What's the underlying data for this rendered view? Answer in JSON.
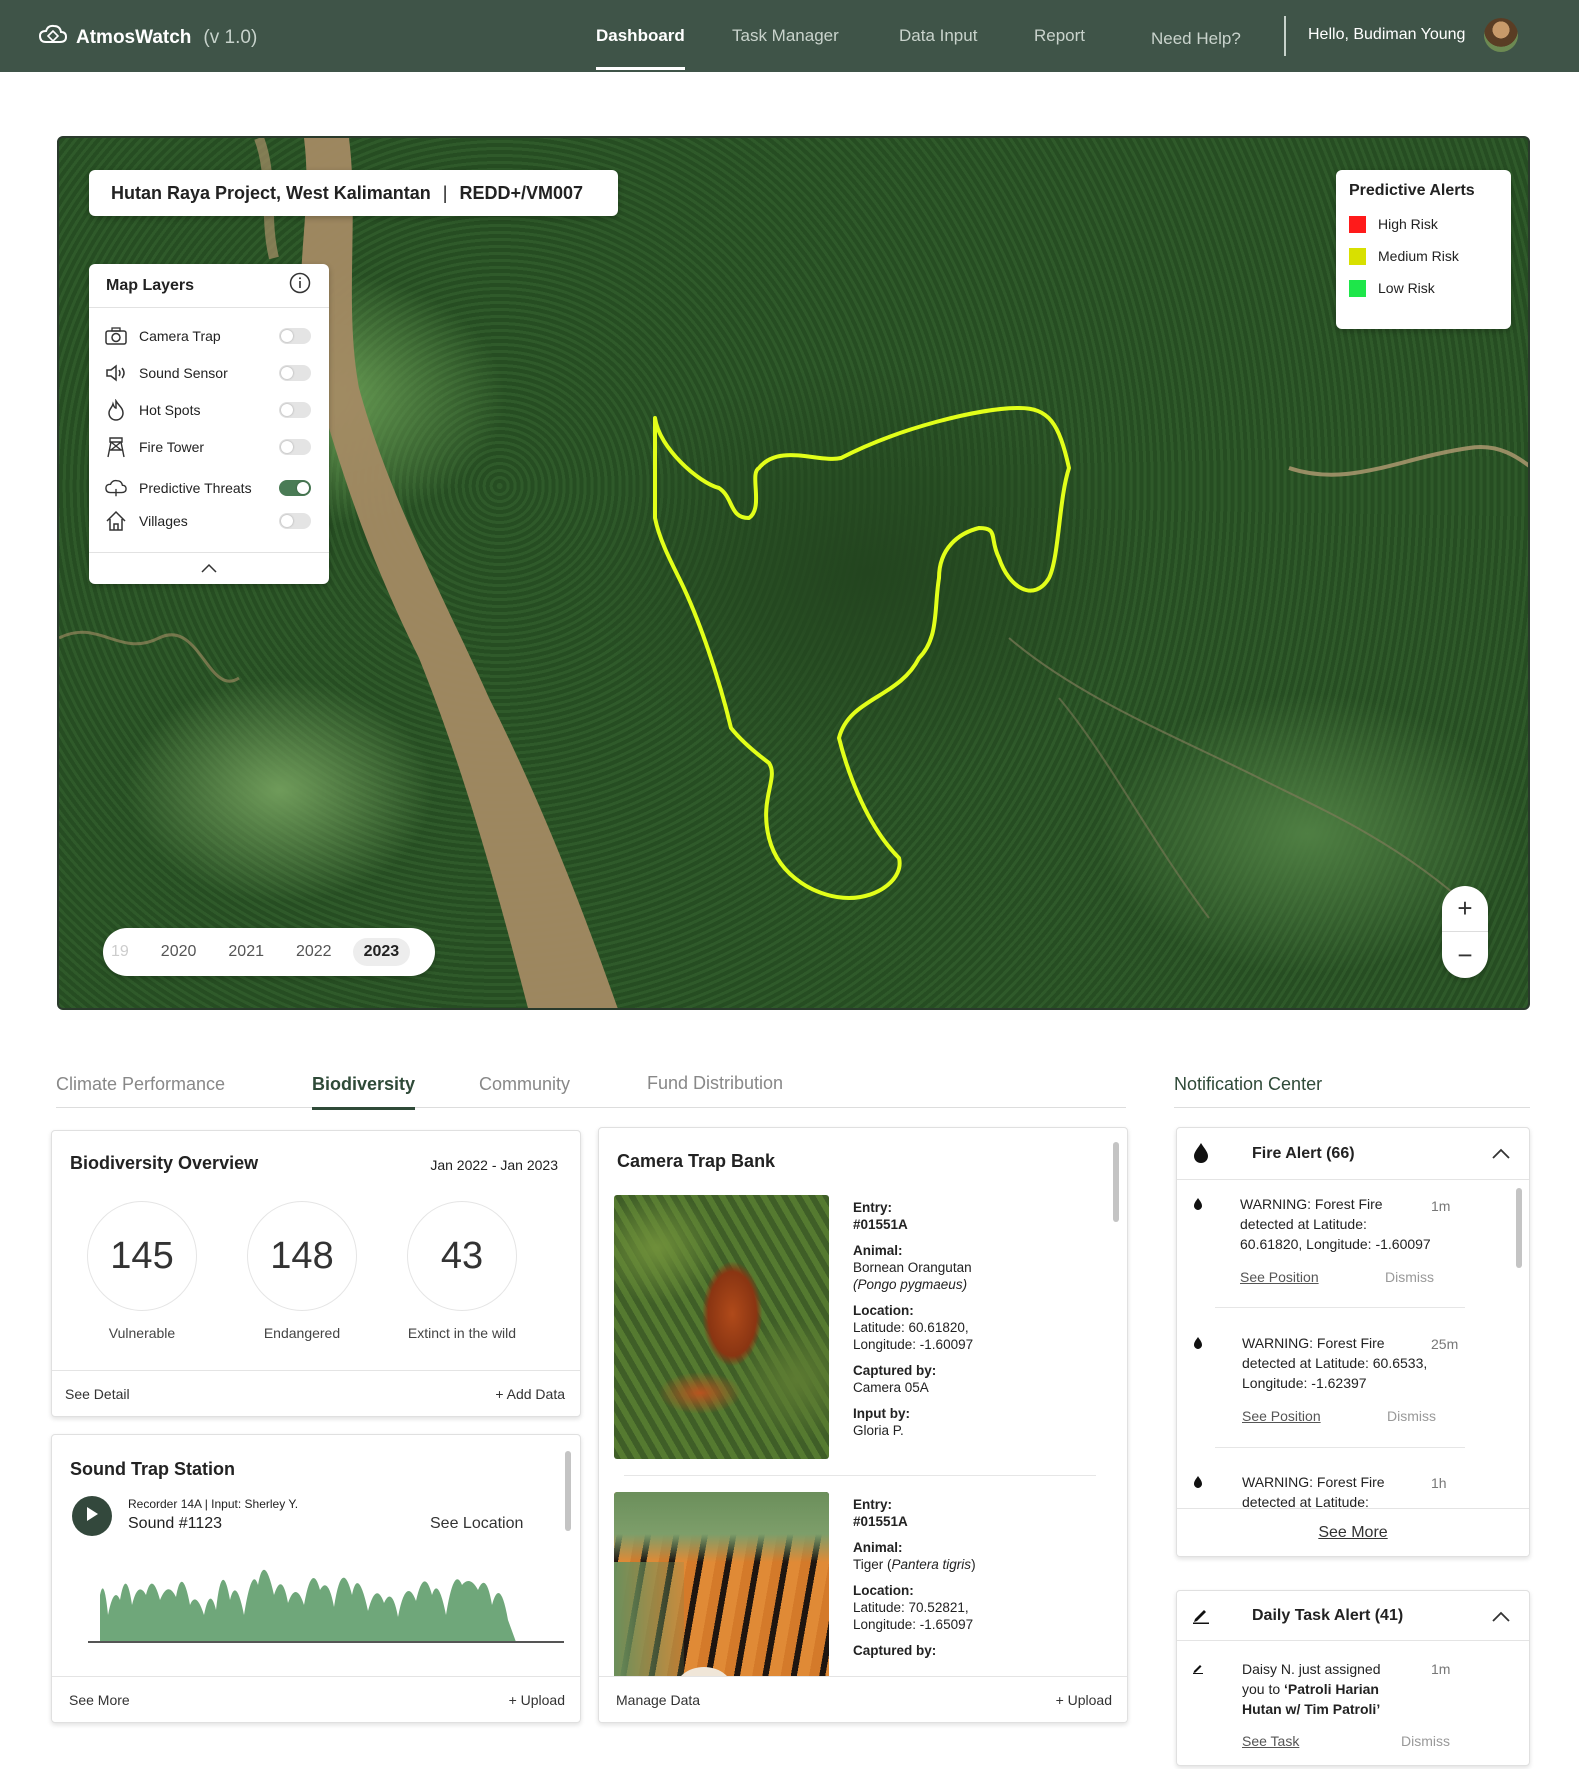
{
  "app": {
    "name": "AtmosWatch",
    "version": "(v 1.0)"
  },
  "nav": {
    "items": [
      {
        "label": "Dashboard"
      },
      {
        "label": "Task Manager"
      },
      {
        "label": "Data Input"
      },
      {
        "label": "Report"
      },
      {
        "label": "Need Help?"
      }
    ],
    "active": "Dashboard"
  },
  "user": {
    "greeting": "Hello, Budiman Young"
  },
  "map": {
    "project_title": "Hutan Raya Project, West Kalimantan",
    "project_code": "REDD+/VM007",
    "layers": {
      "title": "Map Layers",
      "items": [
        {
          "label": "Camera Trap",
          "icon": "camera-icon",
          "on": false
        },
        {
          "label": "Sound Sensor",
          "icon": "speaker-icon",
          "on": false
        },
        {
          "label": "Hot Spots",
          "icon": "flame-icon",
          "on": false
        },
        {
          "label": "Fire Tower",
          "icon": "tower-icon",
          "on": false
        },
        {
          "label": "Predictive Threats",
          "icon": "cloud-icon",
          "on": true
        },
        {
          "label": "Villages",
          "icon": "house-icon",
          "on": false
        }
      ]
    },
    "legend": {
      "title": "Predictive Alerts",
      "items": [
        {
          "label": "High Risk",
          "color": "#ff1a1a"
        },
        {
          "label": "Medium Risk",
          "color": "#d8e000"
        },
        {
          "label": "Low Risk",
          "color": "#1ee64a"
        }
      ]
    },
    "years": [
      "19",
      "2020",
      "2021",
      "2022",
      "2023"
    ],
    "active_year": "2023",
    "zoom_in": "+",
    "zoom_out": "−",
    "boundary_color": "#e2ff1a"
  },
  "tabs": [
    {
      "label": "Climate Performance"
    },
    {
      "label": "Biodiversity"
    },
    {
      "label": "Community"
    },
    {
      "label": "Fund Distribution"
    }
  ],
  "active_tab": "Biodiversity",
  "notification_center": {
    "title": "Notification Center"
  },
  "biodiversity": {
    "title": "Biodiversity Overview",
    "range": "Jan 2022 - Jan 2023",
    "stats": [
      {
        "value": "145",
        "label": "Vulnerable"
      },
      {
        "value": "148",
        "label": "Endangered"
      },
      {
        "value": "43",
        "label": "Extinct in the wild"
      }
    ],
    "see_detail": "See Detail",
    "add_data": "+ Add Data"
  },
  "sound": {
    "title": "Sound Trap Station",
    "recorder": "Recorder 14A | Input: Sherley Y.",
    "sound_name": "Sound #1123",
    "see_location": "See Location",
    "see_more": "See More",
    "upload": "+ Upload"
  },
  "camera": {
    "title": "Camera Trap Bank",
    "labels": {
      "entry": "Entry:",
      "animal": "Animal:",
      "location": "Location:",
      "captured": "Captured by:",
      "input": "Input by:"
    },
    "entries": [
      {
        "entry": "#01551A",
        "animal": "Bornean Orangutan",
        "latin": "(Pongo pygmaeus)",
        "lat": "Latitude: 60.61820,",
        "lon": "Longitude: -1.60097",
        "captured": "Camera 05A",
        "input": "Gloria P."
      },
      {
        "entry": "#01551A",
        "animal_prefix": "Tiger (",
        "latin": "Pantera tigris",
        "animal_suffix": ")",
        "lat": "Latitude: 70.52821,",
        "lon": "Longitude: -1.65097"
      }
    ],
    "manage": "Manage Data",
    "upload": "+ Upload"
  },
  "fire": {
    "title": "Fire Alert (66)",
    "items": [
      {
        "l1": "WARNING: Forest Fire",
        "l2": "detected at Latitude:",
        "l3": "60.61820, Longitude: -1.60097",
        "time": "1m"
      },
      {
        "l1": "WARNING: Forest Fire",
        "l2": "detected at Latitude: 60.6533,",
        "l3": "Longitude: -1.62397",
        "time": "25m"
      },
      {
        "l1": "WARNING: Forest Fire",
        "l2": "detected at Latitude:",
        "time": "1h"
      }
    ],
    "see_position": "See Position",
    "dismiss": "Dismiss",
    "see_more": "See More"
  },
  "task": {
    "title": "Daily Task Alert (41)",
    "items": [
      {
        "l1": "Daisy N. just assigned",
        "l2_prefix": "you to ",
        "l2_bold": "‘Patroli Harian",
        "l3": "Hutan w/ Tim Patroli’",
        "time": "1m"
      }
    ],
    "see_task": "See Task",
    "dismiss": "Dismiss"
  }
}
